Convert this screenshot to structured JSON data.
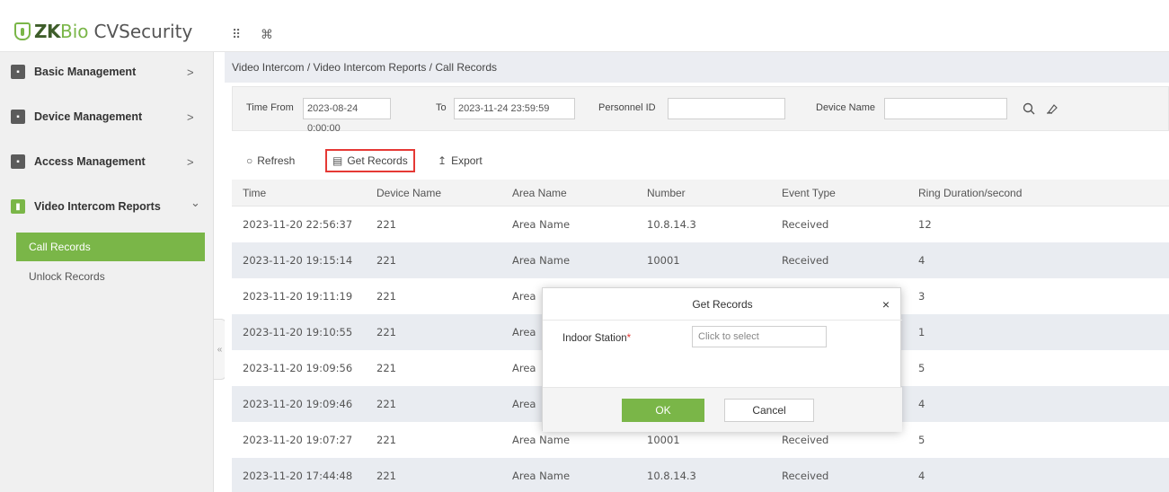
{
  "app": {
    "logo_zk": "ZK",
    "logo_bio": "Bio",
    "logo_cv": "CVSecurity",
    "grid_icon": "⠿",
    "cmd_icon": "⌘"
  },
  "sidebar": {
    "items": [
      {
        "label": "Basic Management",
        "arrow": ">"
      },
      {
        "label": "Device Management",
        "arrow": ">"
      },
      {
        "label": "Access Management",
        "arrow": ">"
      },
      {
        "label": "Video Intercom Reports",
        "arrow": "⌄"
      }
    ],
    "subitems": [
      {
        "label": "Call Records",
        "active": true
      },
      {
        "label": "Unlock Records",
        "active": false
      }
    ],
    "collapse_glyph": "«"
  },
  "breadcrumb": "Video Intercom / Video Intercom Reports / Call Records",
  "filters": {
    "time_from_label": "Time From",
    "time_from_value": "2023-08-24 0:00:00",
    "to_label": "To",
    "to_value": "2023-11-24 23:59:59",
    "personnel_id_label": "Personnel ID",
    "personnel_id_value": "",
    "device_name_label": "Device Name",
    "device_name_value": ""
  },
  "toolbar": {
    "refresh": "Refresh",
    "get_records": "Get Records",
    "export": "Export"
  },
  "table": {
    "columns": [
      "Time",
      "Device Name",
      "Area Name",
      "Number",
      "Event Type",
      "Ring Duration/second"
    ],
    "rows": [
      [
        "2023-11-20 22:56:37",
        "221",
        "Area Name",
        "10.8.14.3",
        "Received",
        "12"
      ],
      [
        "2023-11-20 19:15:14",
        "221",
        "Area Name",
        "10001",
        "Received",
        "4"
      ],
      [
        "2023-11-20 19:11:19",
        "221",
        "Area",
        "",
        "",
        "3"
      ],
      [
        "2023-11-20 19:10:55",
        "221",
        "Area",
        "",
        "",
        "1"
      ],
      [
        "2023-11-20 19:09:56",
        "221",
        "Area",
        "",
        "",
        "5"
      ],
      [
        "2023-11-20 19:09:46",
        "221",
        "Area",
        "",
        "",
        "4"
      ],
      [
        "2023-11-20 19:07:27",
        "221",
        "Area Name",
        "10001",
        "Received",
        "5"
      ],
      [
        "2023-11-20 17:44:48",
        "221",
        "Area Name",
        "10.8.14.3",
        "Received",
        "4"
      ]
    ]
  },
  "dialog": {
    "title": "Get Records",
    "close": "×",
    "field_label": "Indoor Station",
    "required_mark": "*",
    "field_placeholder": "Click to select",
    "ok": "OK",
    "cancel": "Cancel"
  },
  "colors": {
    "accent": "#7ab648",
    "highlight_border": "#e53935"
  }
}
